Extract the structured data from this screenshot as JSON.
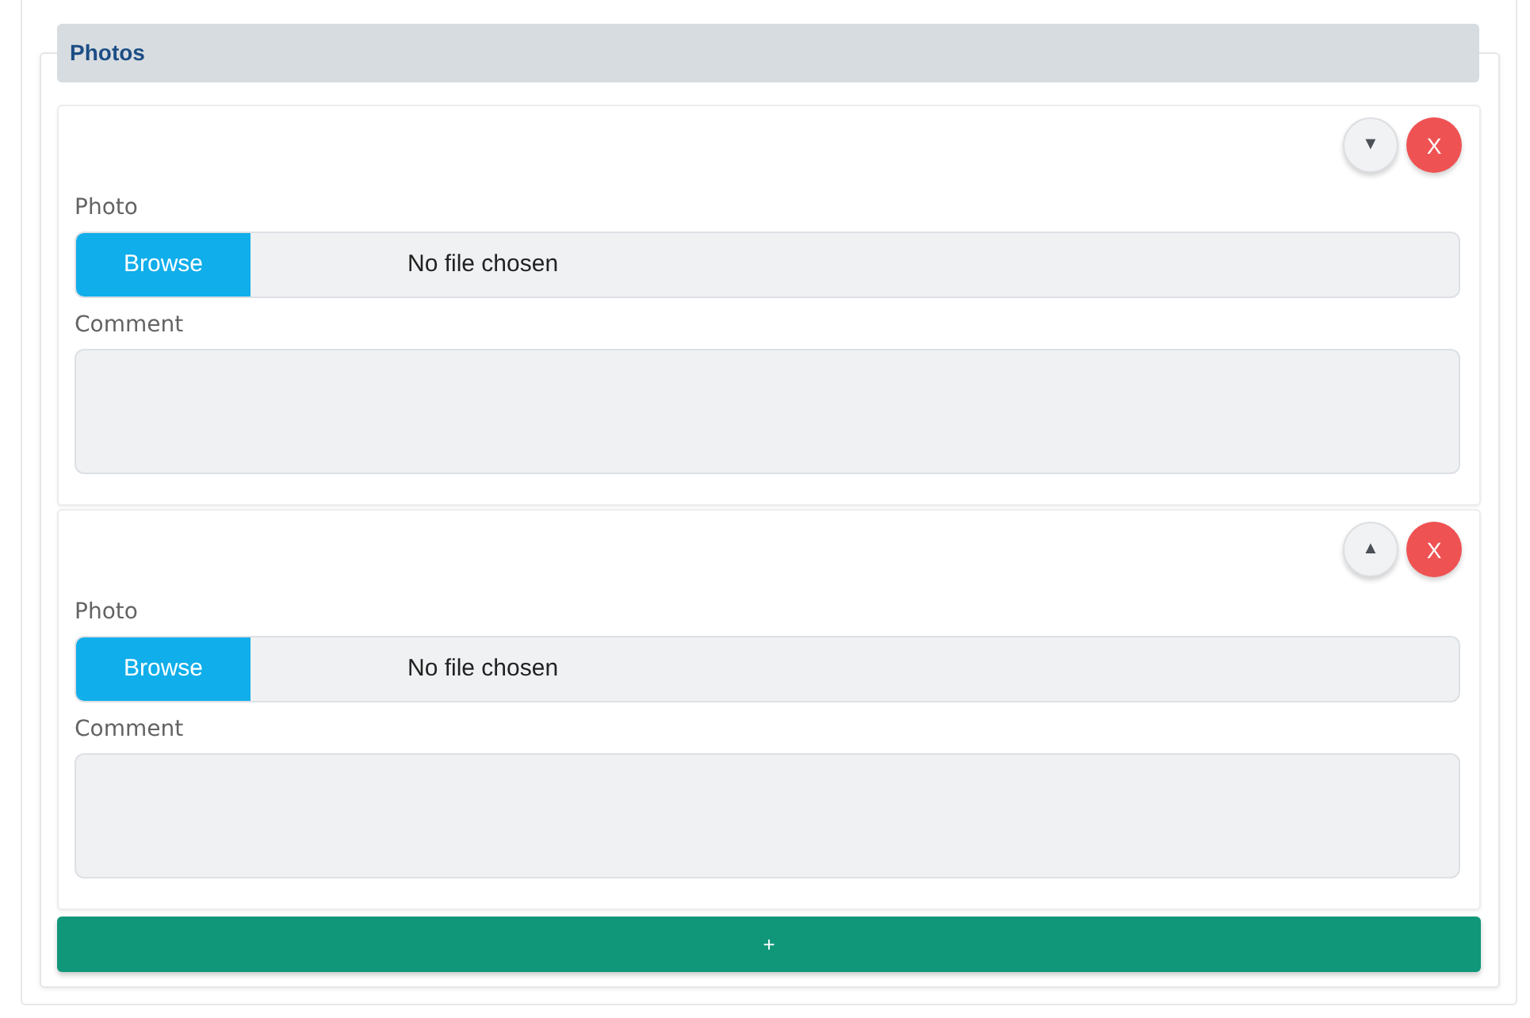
{
  "section": {
    "title": "Photos"
  },
  "entries": [
    {
      "move_button": "▼",
      "remove_button": "X",
      "photo": {
        "label": "Photo",
        "button": "Browse",
        "status": "No file chosen"
      },
      "comment": {
        "label": "Comment"
      }
    },
    {
      "move_button": "▲",
      "remove_button": "X",
      "photo": {
        "label": "Photo",
        "button": "Browse",
        "status": "No file chosen"
      },
      "comment": {
        "label": "Comment"
      }
    }
  ],
  "add_button": "+"
}
